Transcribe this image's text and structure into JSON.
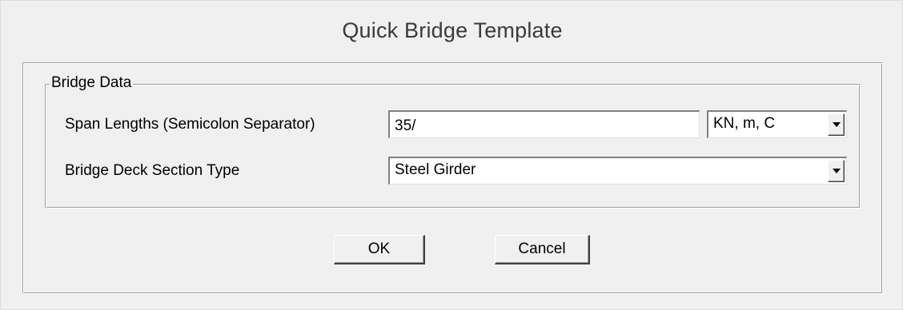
{
  "dialog": {
    "title": "Quick Bridge Template"
  },
  "bridge_data": {
    "group_label": "Bridge Data",
    "span_lengths": {
      "label": "Span Lengths  (Semicolon Separator)",
      "value": "35/"
    },
    "units": {
      "selected": "KN, m, C"
    },
    "deck_section": {
      "label": "Bridge Deck Section Type",
      "selected": "Steel Girder"
    }
  },
  "buttons": {
    "ok": "OK",
    "cancel": "Cancel"
  },
  "icons": {
    "dropdown": "chevron-down-icon"
  }
}
